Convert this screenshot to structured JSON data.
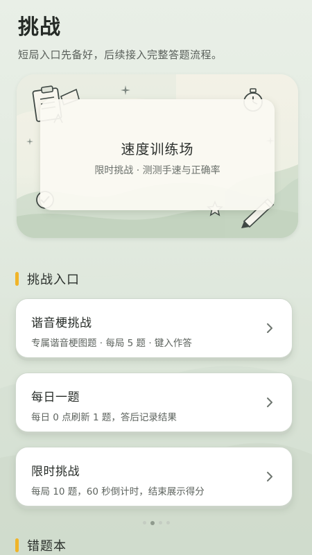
{
  "header": {
    "title": "挑战",
    "subtitle": "短局入口先备好，后续接入完整答题流程。"
  },
  "banner": {
    "title": "速度训练场",
    "subtitle": "限时挑战 · 测测手速与正确率",
    "icons": [
      "clipboard-icon",
      "stopwatch-icon",
      "check-circle-icon",
      "star-icon",
      "pencil-icon",
      "sparkle-icon"
    ]
  },
  "sections": {
    "challenge_entry_label": "挑战入口",
    "wrong_book_label": "错题本"
  },
  "entries": [
    {
      "title": "谐音梗挑战",
      "desc": "专属谐音梗图题 · 每局 5 题 · 键入作答"
    },
    {
      "title": "每日一题",
      "desc": "每日 0 点刷新 1 题，答后记录结果"
    },
    {
      "title": "限时挑战",
      "desc": "每局 10 题，60 秒倒计时，结束展示得分"
    }
  ],
  "pager": {
    "count": 4,
    "active_index": 1
  },
  "colors": {
    "accent": "#f0b429",
    "background": "#e3ebe1",
    "card": "#ffffff"
  }
}
